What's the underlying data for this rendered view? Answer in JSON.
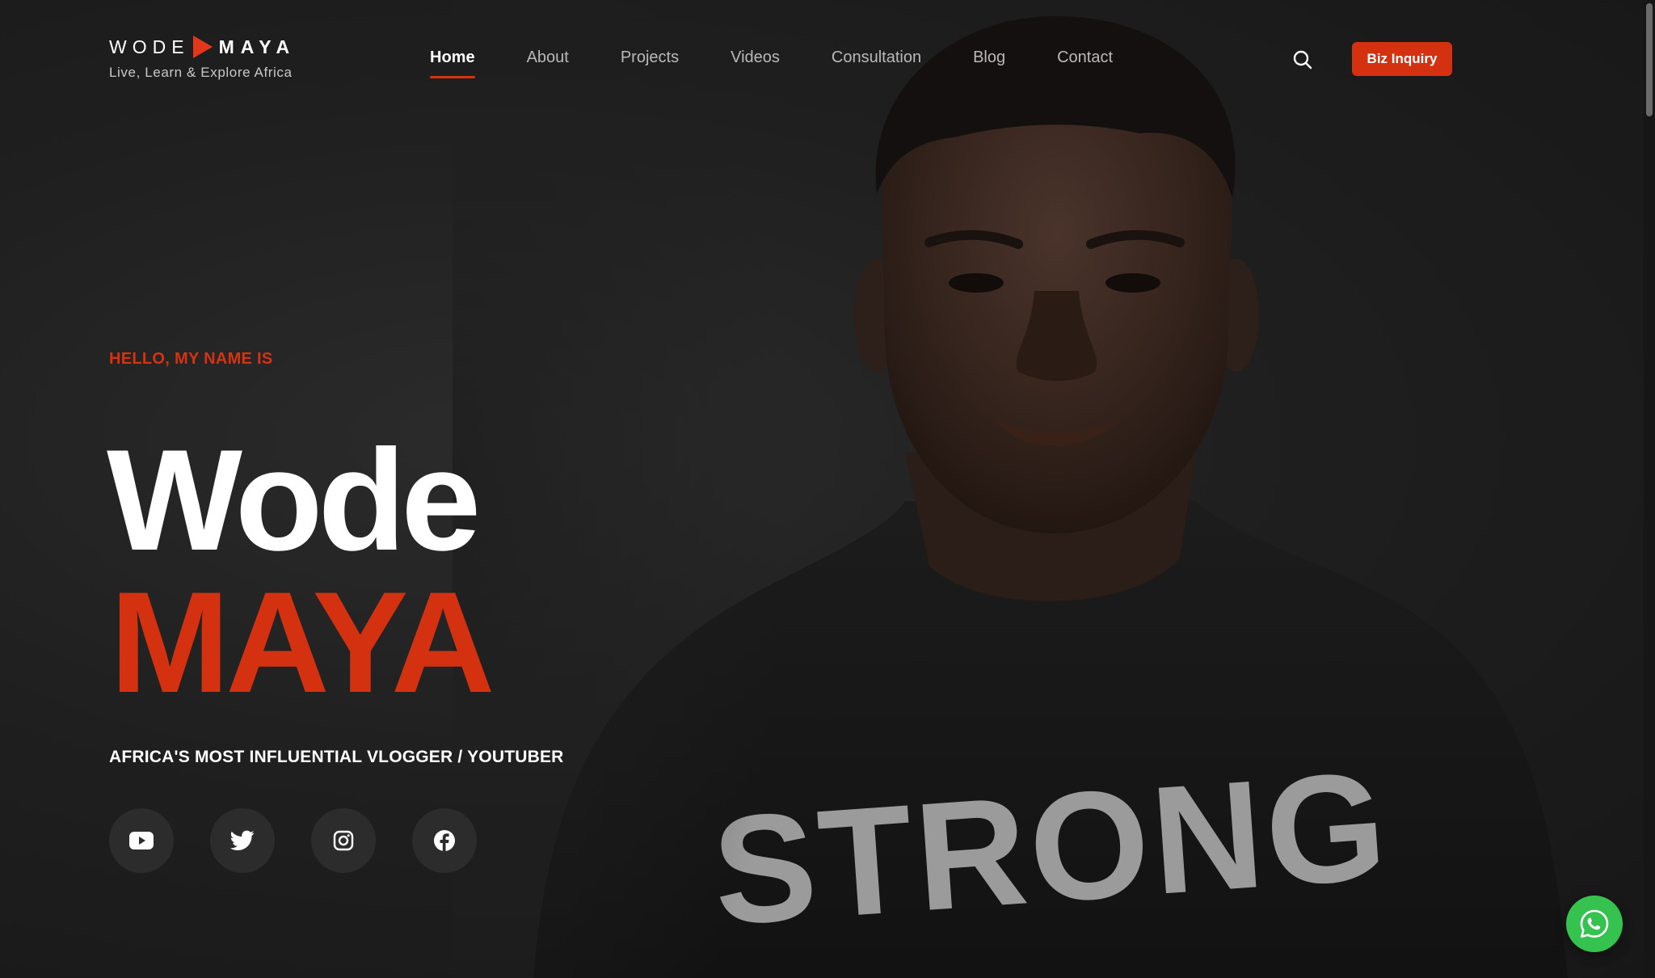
{
  "brand": {
    "name_part1": "WODE",
    "name_part2": "MAYA",
    "tagline": "Live, Learn & Explore Africa",
    "accent_color": "#d3310f"
  },
  "nav": {
    "items": [
      {
        "label": "Home",
        "active": true
      },
      {
        "label": "About",
        "active": false
      },
      {
        "label": "Projects",
        "active": false
      },
      {
        "label": "Videos",
        "active": false
      },
      {
        "label": "Consultation",
        "active": false
      },
      {
        "label": "Blog",
        "active": false
      },
      {
        "label": "Contact",
        "active": false
      }
    ],
    "search_icon": "search-icon",
    "cta_label": "Biz Inquiry"
  },
  "hero": {
    "eyebrow": "HELLO, MY NAME IS",
    "first_name": "Wode",
    "last_name": "MAYA",
    "subtitle": "AFRICA'S MOST INFLUENTIAL VLOGGER / YOUTUBER",
    "shirt_text": "STRONG"
  },
  "socials": [
    {
      "icon": "youtube-icon"
    },
    {
      "icon": "twitter-icon"
    },
    {
      "icon": "instagram-icon"
    },
    {
      "icon": "facebook-icon"
    }
  ],
  "floating": {
    "icon": "whatsapp-icon",
    "color": "#35c24e"
  }
}
